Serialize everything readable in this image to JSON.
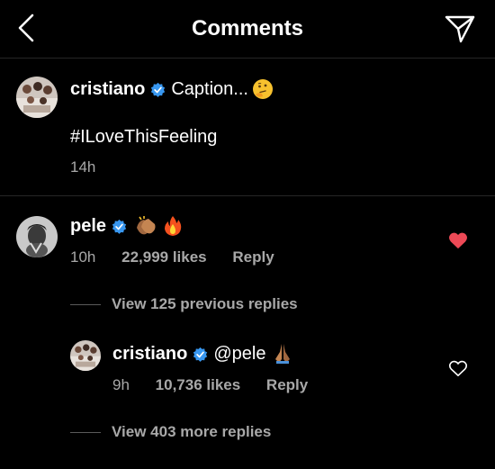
{
  "header": {
    "title": "Comments"
  },
  "post": {
    "username": "cristiano",
    "caption": "Caption...",
    "hashtag": "#ILoveThisFeeling",
    "time": "14h"
  },
  "comment": {
    "username": "pele",
    "time": "10h",
    "likes": "22,999 likes",
    "reply_label": "Reply",
    "liked": true,
    "view_previous": "View 125 previous replies"
  },
  "reply": {
    "username": "cristiano",
    "text": "@pele",
    "time": "9h",
    "likes": "10,736 likes",
    "reply_label": "Reply",
    "liked": false,
    "view_more": "View 403 more replies"
  },
  "colors": {
    "background": "#000000",
    "verified": "#3897f0",
    "like_red": "#ed4956",
    "muted": "#a8a8a8"
  }
}
